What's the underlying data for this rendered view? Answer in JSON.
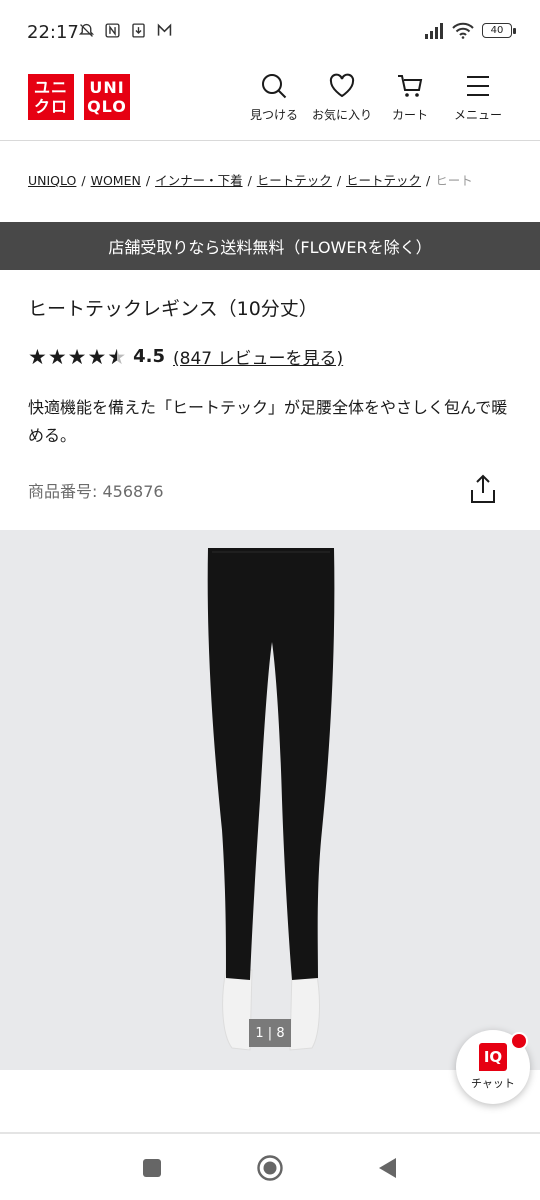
{
  "status_bar": {
    "time": "22:17",
    "battery": "40"
  },
  "header": {
    "logo_top": [
      "ユニ",
      "クロ"
    ],
    "logo_bottom": [
      "UNI",
      "QLO"
    ],
    "nav": [
      {
        "label": "見つける",
        "icon": "search-icon"
      },
      {
        "label": "お気に入り",
        "icon": "heart-icon"
      },
      {
        "label": "カート",
        "icon": "cart-icon"
      },
      {
        "label": "メニュー",
        "icon": "menu-icon"
      }
    ]
  },
  "breadcrumb": [
    "UNIQLO",
    "WOMEN",
    "インナー・下着",
    "ヒートテック",
    "ヒートテック",
    "ヒート"
  ],
  "promo": {
    "text": "店舗受取りなら送料無料（FLOWERを除く）"
  },
  "product": {
    "title": "ヒートテックレギンス（10分丈）",
    "rating": 4.5,
    "rating_text": "4.5",
    "reviews_text": "(847 レビューを見る)",
    "description": "快適機能を備えた「ヒートテック」が足腰全体をやさしく包んで暖める。",
    "product_number": "商品番号: 456876"
  },
  "gallery": {
    "counter": "1 | 8"
  },
  "chat": {
    "badge": "IQ",
    "label": "チャット"
  },
  "colors": {
    "brand_red": "#e60012",
    "banner_gray": "#484848",
    "gallery_bg": "#e8e9eb"
  }
}
